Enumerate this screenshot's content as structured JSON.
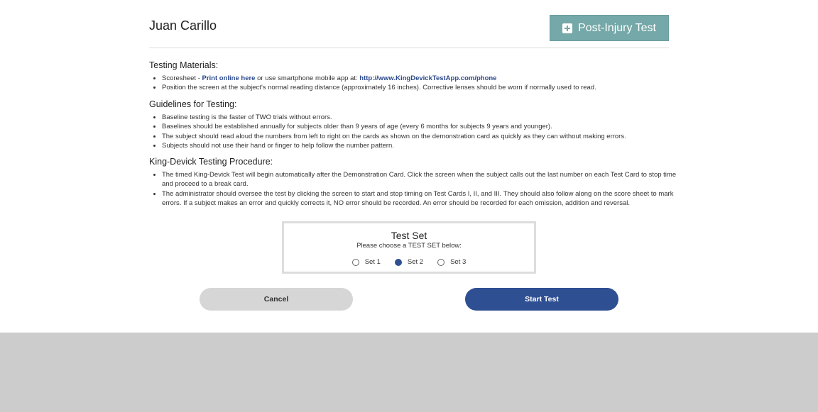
{
  "header": {
    "name": "Juan Carillo",
    "post_injury_label": "Post-Injury Test"
  },
  "testing_materials": {
    "title": "Testing Materials:",
    "item1_prefix": "Scoresheet - ",
    "item1_link": "Print online here",
    "item1_middle": " or use smartphone mobile app at: ",
    "item1_url": "http://www.KingDevickTestApp.com/phone",
    "item2": "Position the screen at the subject's normal reading distance (approximately 16 inches). Corrective lenses should be worn if normally used to read."
  },
  "guidelines": {
    "title": "Guidelines for Testing:",
    "items": [
      "Baseline testing is the faster of TWO trials without errors.",
      "Baselines should be established annually for subjects older than 9 years of age (every 6 months for subjects 9 years and younger).",
      "The subject should read aloud the numbers from left to right on the cards as shown on the demonstration card as quickly as they can without making errors.",
      "Subjects should not use their hand or finger to help follow the number pattern."
    ]
  },
  "procedure": {
    "title": "King-Devick Testing Procedure:",
    "items": [
      "The timed King-Devick Test will begin automatically after the Demonstration Card. Click the screen when the subject calls out the last number on each Test Card to stop time and proceed to a break card.",
      "The administrator should oversee the test by clicking the screen to start and stop timing on Test Cards I, II, and III. They should also follow along on the score sheet to mark errors. If a subject makes an error and quickly corrects it, NO error should be recorded. An error should be recorded for each omission, addition and reversal."
    ]
  },
  "test_set": {
    "title": "Test Set",
    "subtitle": "Please choose a TEST SET below:",
    "options": [
      "Set 1",
      "Set 2",
      "Set 3"
    ],
    "selected": "Set 2"
  },
  "actions": {
    "cancel_label": "Cancel",
    "start_label": "Start Test"
  },
  "colors": {
    "post_injury_button": "#75a8a8",
    "primary": "#2f4f93",
    "cancel_button": "#d6d6d6",
    "background_footer": "#cccccc"
  }
}
